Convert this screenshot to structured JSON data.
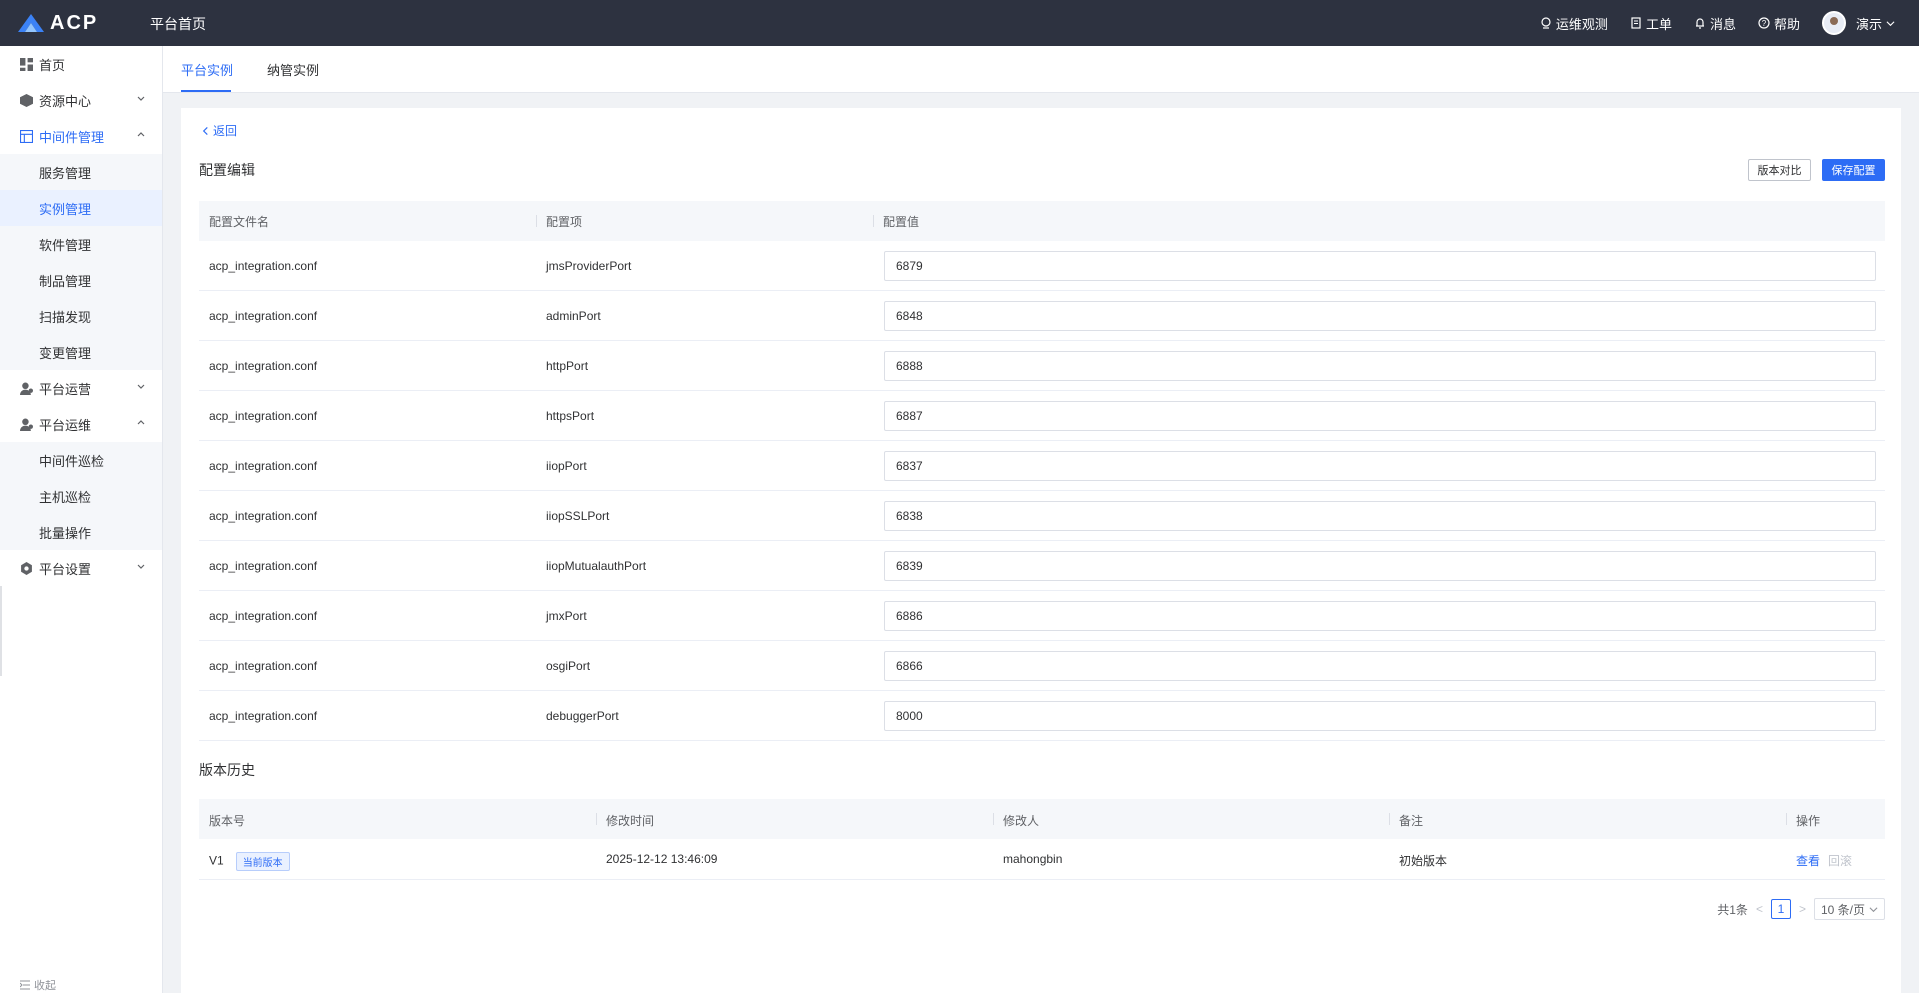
{
  "header": {
    "logo_text": "ACP",
    "title": "平台首页",
    "items": [
      {
        "icon": "monitor-icon",
        "label": "运维观测"
      },
      {
        "icon": "ticket-icon",
        "label": "工单"
      },
      {
        "icon": "bell-icon",
        "label": "消息"
      },
      {
        "icon": "help-icon",
        "label": "帮助"
      }
    ],
    "user": "演示"
  },
  "sidebar": {
    "items": [
      {
        "label": "首页"
      },
      {
        "label": "资源中心"
      },
      {
        "label": "中间件管理"
      },
      {
        "label": "服务管理"
      },
      {
        "label": "实例管理"
      },
      {
        "label": "软件管理"
      },
      {
        "label": "制品管理"
      },
      {
        "label": "扫描发现"
      },
      {
        "label": "变更管理"
      },
      {
        "label": "平台运营"
      },
      {
        "label": "平台运维"
      },
      {
        "label": "中间件巡检"
      },
      {
        "label": "主机巡检"
      },
      {
        "label": "批量操作"
      },
      {
        "label": "平台设置"
      }
    ],
    "collapse_label": "收起"
  },
  "tabs": [
    {
      "label": "平台实例",
      "active": true
    },
    {
      "label": "纳管实例",
      "active": false
    }
  ],
  "main": {
    "back_label": "返回",
    "config_title": "配置编辑",
    "compare_button": "版本对比",
    "save_button": "保存配置",
    "config_headers": [
      "配置文件名",
      "配置项",
      "配置值"
    ],
    "config_rows": [
      {
        "file": "acp_integration.conf",
        "key": "jmsProviderPort",
        "value": "6879"
      },
      {
        "file": "acp_integration.conf",
        "key": "adminPort",
        "value": "6848"
      },
      {
        "file": "acp_integration.conf",
        "key": "httpPort",
        "value": "6888"
      },
      {
        "file": "acp_integration.conf",
        "key": "httpsPort",
        "value": "6887"
      },
      {
        "file": "acp_integration.conf",
        "key": "iiopPort",
        "value": "6837"
      },
      {
        "file": "acp_integration.conf",
        "key": "iiopSSLPort",
        "value": "6838"
      },
      {
        "file": "acp_integration.conf",
        "key": "iiopMutualauthPort",
        "value": "6839"
      },
      {
        "file": "acp_integration.conf",
        "key": "jmxPort",
        "value": "6886"
      },
      {
        "file": "acp_integration.conf",
        "key": "osgiPort",
        "value": "6866"
      },
      {
        "file": "acp_integration.conf",
        "key": "debuggerPort",
        "value": "8000"
      }
    ],
    "history_title": "版本历史",
    "history_headers": [
      "版本号",
      "修改时间",
      "修改人",
      "备注",
      "操作"
    ],
    "history_rows": [
      {
        "version": "V1",
        "tag": "当前版本",
        "time": "2025-12-12 13:46:09",
        "user": "mahongbin",
        "note": "初始版本",
        "view": "查看",
        "rollback": "回滚"
      }
    ],
    "pagination": {
      "total": "共1条",
      "page": "1",
      "size": "10 条/页"
    }
  },
  "colors": {
    "accent": "#2d6cf5",
    "topbar": "#2d3240"
  }
}
